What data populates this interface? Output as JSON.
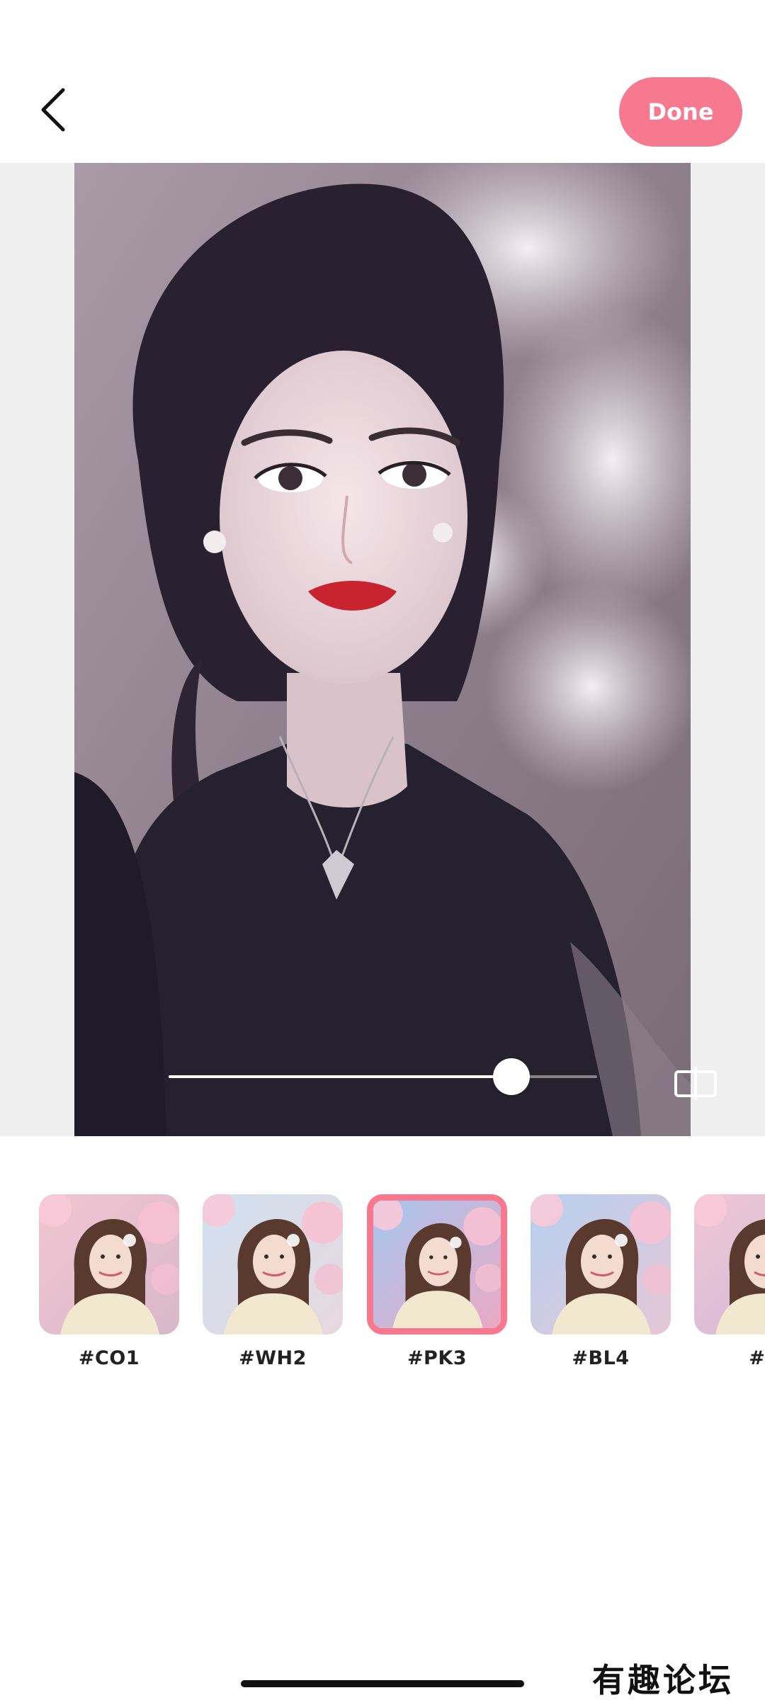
{
  "header": {
    "back_icon": "chevron-left-icon",
    "done_label": "Done",
    "accent_color": "#f7798f"
  },
  "editor": {
    "slider_value": 0.8,
    "compare_icon": "compare-icon"
  },
  "filters": [
    {
      "label": "#CO1",
      "selected": false
    },
    {
      "label": "#WH2",
      "selected": false
    },
    {
      "label": "#PK3",
      "selected": true
    },
    {
      "label": "#BL4",
      "selected": false
    },
    {
      "label": "#P",
      "selected": false
    }
  ],
  "watermark": "有趣论坛"
}
